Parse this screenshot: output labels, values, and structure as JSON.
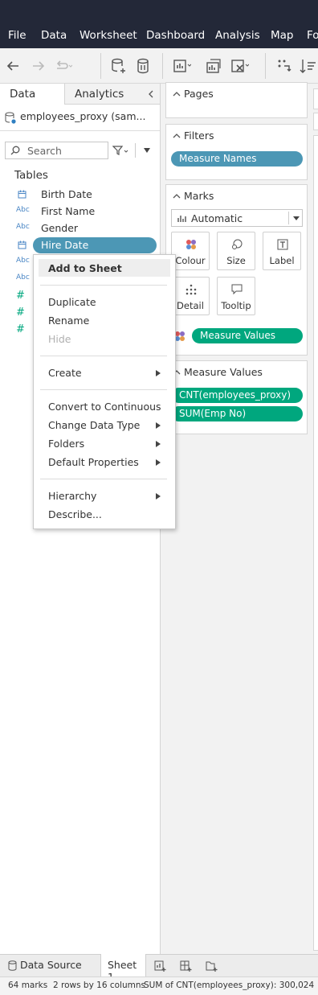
{
  "menu": [
    "File",
    "Data",
    "Worksheet",
    "Dashboard",
    "Analysis",
    "Map",
    "Fo"
  ],
  "left_panel": {
    "tabs": [
      "Data",
      "Analytics"
    ],
    "datasource": "employees_proxy (sam...",
    "search_placeholder": "Search",
    "tables_heading": "Tables",
    "fields": [
      {
        "type": "date",
        "name": "Birth Date"
      },
      {
        "type": "Abc",
        "name": "First Name"
      },
      {
        "type": "Abc",
        "name": "Gender"
      },
      {
        "type": "date",
        "name": "Hire Date",
        "selected": true
      },
      {
        "type": "Abc",
        "name": ""
      },
      {
        "type": "Abc",
        "name": ""
      },
      {
        "type": "#",
        "name": ""
      },
      {
        "type": "#",
        "name": ""
      },
      {
        "type": "#",
        "name": ""
      }
    ]
  },
  "context_menu": {
    "items": [
      {
        "label": "Add to Sheet",
        "bold": true
      },
      {
        "label": "Duplicate"
      },
      {
        "label": "Rename"
      },
      {
        "label": "Hide",
        "disabled": true
      },
      {
        "label": "Create",
        "submenu": true
      },
      {
        "label": "Convert to Continuous"
      },
      {
        "label": "Change Data Type",
        "submenu": true
      },
      {
        "label": "Folders",
        "submenu": true
      },
      {
        "label": "Default Properties",
        "submenu": true
      },
      {
        "label": "Hierarchy",
        "submenu": true
      },
      {
        "label": "Describe..."
      }
    ]
  },
  "shelves": {
    "pages_title": "Pages",
    "filters_title": "Filters",
    "filters_pill": "Measure Names",
    "marks_title": "Marks",
    "mark_type": "Automatic",
    "mark_buttons": [
      "Colour",
      "Size",
      "Label",
      "Detail",
      "Tooltip"
    ],
    "marks_pill": "Measure Values",
    "measure_values_title": "Measure Values",
    "measure_values_pills": [
      "CNT(employees_proxy)",
      "SUM(Emp No)"
    ]
  },
  "bottom_tabs": {
    "data_source": "Data Source",
    "sheet": "Sheet 1"
  },
  "status": {
    "marks": "64 marks",
    "dims": "2 rows by 16 columns",
    "sum": "SUM of CNT(employees_proxy): 300,024"
  },
  "colors": {
    "dark_bar": "#232838",
    "blue_pill": "#4c97b5",
    "green_pill": "#00a77e"
  }
}
